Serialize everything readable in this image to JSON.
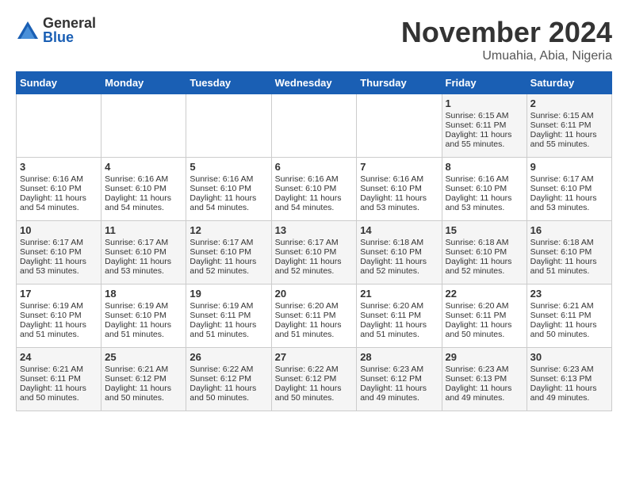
{
  "logo": {
    "general": "General",
    "blue": "Blue"
  },
  "title": "November 2024",
  "location": "Umuahia, Abia, Nigeria",
  "days_of_week": [
    "Sunday",
    "Monday",
    "Tuesday",
    "Wednesday",
    "Thursday",
    "Friday",
    "Saturday"
  ],
  "weeks": [
    [
      {
        "day": "",
        "info": ""
      },
      {
        "day": "",
        "info": ""
      },
      {
        "day": "",
        "info": ""
      },
      {
        "day": "",
        "info": ""
      },
      {
        "day": "",
        "info": ""
      },
      {
        "day": "1",
        "info": "Sunrise: 6:15 AM\nSunset: 6:11 PM\nDaylight: 11 hours and 55 minutes."
      },
      {
        "day": "2",
        "info": "Sunrise: 6:15 AM\nSunset: 6:11 PM\nDaylight: 11 hours and 55 minutes."
      }
    ],
    [
      {
        "day": "3",
        "info": "Sunrise: 6:16 AM\nSunset: 6:10 PM\nDaylight: 11 hours and 54 minutes."
      },
      {
        "day": "4",
        "info": "Sunrise: 6:16 AM\nSunset: 6:10 PM\nDaylight: 11 hours and 54 minutes."
      },
      {
        "day": "5",
        "info": "Sunrise: 6:16 AM\nSunset: 6:10 PM\nDaylight: 11 hours and 54 minutes."
      },
      {
        "day": "6",
        "info": "Sunrise: 6:16 AM\nSunset: 6:10 PM\nDaylight: 11 hours and 54 minutes."
      },
      {
        "day": "7",
        "info": "Sunrise: 6:16 AM\nSunset: 6:10 PM\nDaylight: 11 hours and 53 minutes."
      },
      {
        "day": "8",
        "info": "Sunrise: 6:16 AM\nSunset: 6:10 PM\nDaylight: 11 hours and 53 minutes."
      },
      {
        "day": "9",
        "info": "Sunrise: 6:17 AM\nSunset: 6:10 PM\nDaylight: 11 hours and 53 minutes."
      }
    ],
    [
      {
        "day": "10",
        "info": "Sunrise: 6:17 AM\nSunset: 6:10 PM\nDaylight: 11 hours and 53 minutes."
      },
      {
        "day": "11",
        "info": "Sunrise: 6:17 AM\nSunset: 6:10 PM\nDaylight: 11 hours and 53 minutes."
      },
      {
        "day": "12",
        "info": "Sunrise: 6:17 AM\nSunset: 6:10 PM\nDaylight: 11 hours and 52 minutes."
      },
      {
        "day": "13",
        "info": "Sunrise: 6:17 AM\nSunset: 6:10 PM\nDaylight: 11 hours and 52 minutes."
      },
      {
        "day": "14",
        "info": "Sunrise: 6:18 AM\nSunset: 6:10 PM\nDaylight: 11 hours and 52 minutes."
      },
      {
        "day": "15",
        "info": "Sunrise: 6:18 AM\nSunset: 6:10 PM\nDaylight: 11 hours and 52 minutes."
      },
      {
        "day": "16",
        "info": "Sunrise: 6:18 AM\nSunset: 6:10 PM\nDaylight: 11 hours and 51 minutes."
      }
    ],
    [
      {
        "day": "17",
        "info": "Sunrise: 6:19 AM\nSunset: 6:10 PM\nDaylight: 11 hours and 51 minutes."
      },
      {
        "day": "18",
        "info": "Sunrise: 6:19 AM\nSunset: 6:10 PM\nDaylight: 11 hours and 51 minutes."
      },
      {
        "day": "19",
        "info": "Sunrise: 6:19 AM\nSunset: 6:11 PM\nDaylight: 11 hours and 51 minutes."
      },
      {
        "day": "20",
        "info": "Sunrise: 6:20 AM\nSunset: 6:11 PM\nDaylight: 11 hours and 51 minutes."
      },
      {
        "day": "21",
        "info": "Sunrise: 6:20 AM\nSunset: 6:11 PM\nDaylight: 11 hours and 51 minutes."
      },
      {
        "day": "22",
        "info": "Sunrise: 6:20 AM\nSunset: 6:11 PM\nDaylight: 11 hours and 50 minutes."
      },
      {
        "day": "23",
        "info": "Sunrise: 6:21 AM\nSunset: 6:11 PM\nDaylight: 11 hours and 50 minutes."
      }
    ],
    [
      {
        "day": "24",
        "info": "Sunrise: 6:21 AM\nSunset: 6:11 PM\nDaylight: 11 hours and 50 minutes."
      },
      {
        "day": "25",
        "info": "Sunrise: 6:21 AM\nSunset: 6:12 PM\nDaylight: 11 hours and 50 minutes."
      },
      {
        "day": "26",
        "info": "Sunrise: 6:22 AM\nSunset: 6:12 PM\nDaylight: 11 hours and 50 minutes."
      },
      {
        "day": "27",
        "info": "Sunrise: 6:22 AM\nSunset: 6:12 PM\nDaylight: 11 hours and 50 minutes."
      },
      {
        "day": "28",
        "info": "Sunrise: 6:23 AM\nSunset: 6:12 PM\nDaylight: 11 hours and 49 minutes."
      },
      {
        "day": "29",
        "info": "Sunrise: 6:23 AM\nSunset: 6:13 PM\nDaylight: 11 hours and 49 minutes."
      },
      {
        "day": "30",
        "info": "Sunrise: 6:23 AM\nSunset: 6:13 PM\nDaylight: 11 hours and 49 minutes."
      }
    ]
  ]
}
